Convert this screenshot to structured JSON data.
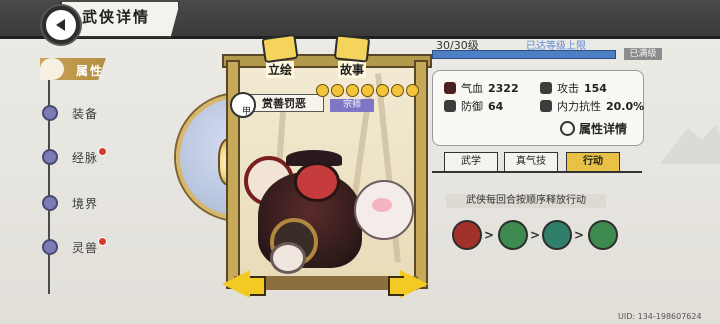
{
  "header": {
    "title": "武侠详情"
  },
  "sidebar": {
    "items": [
      {
        "label": "属性",
        "active": true,
        "badge": false
      },
      {
        "label": "装备",
        "active": false,
        "badge": false
      },
      {
        "label": "经脉",
        "active": false,
        "badge": true
      },
      {
        "label": "境界",
        "active": false,
        "badge": false
      },
      {
        "label": "灵兽",
        "active": false,
        "badge": true
      }
    ]
  },
  "stage": {
    "tabs": [
      {
        "label": "立绘"
      },
      {
        "label": "故事"
      }
    ],
    "character": {
      "name": "赏善罚恶",
      "rank": "宗师",
      "tier": "甲",
      "stars": 7
    }
  },
  "level": {
    "text": "30/30级",
    "max_text": "已达等级上限",
    "badge": "已满级"
  },
  "stats": [
    {
      "label": "气血",
      "value": "2322",
      "icon": "blood-icon"
    },
    {
      "label": "攻击",
      "value": "154",
      "icon": "attack-icon"
    },
    {
      "label": "防御",
      "value": "64",
      "icon": "defense-icon"
    },
    {
      "label": "内力抗性",
      "value": "20.0%",
      "icon": "resist-icon"
    }
  ],
  "detail_button": "属性详情",
  "info_tabs": [
    {
      "label": "武学"
    },
    {
      "label": "真气技"
    },
    {
      "label": "行动",
      "active": true
    }
  ],
  "action_caption": "武侠每回合按顺序释放行动",
  "action_sequence": [
    "attack-icon",
    "heal-icon",
    "buff-icon",
    "heal-icon"
  ],
  "footer": {
    "uid": "UID: 134-198607624"
  },
  "colors": {
    "accent": "#e7c246",
    "level_bar": "#4d7fc4",
    "rank": "#7f77c6",
    "alert": "#d33a2c"
  }
}
